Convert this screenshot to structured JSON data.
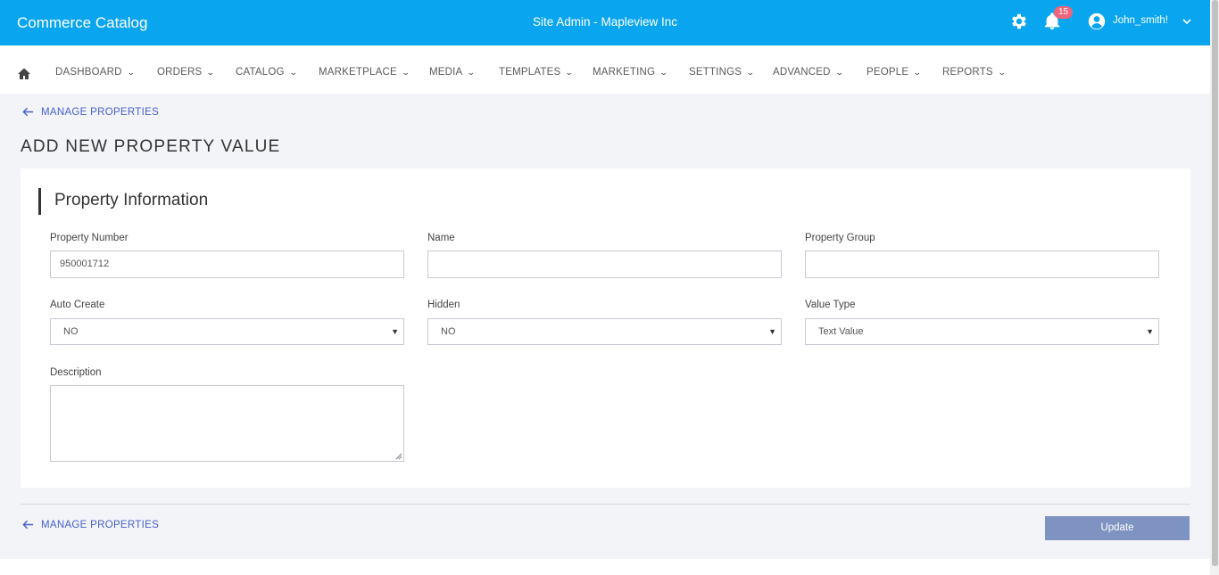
{
  "header": {
    "app_title": "Commerce Catalog",
    "site_title": "Site Admin - Mapleview Inc",
    "notification_count": "15",
    "user_name": "John_smith!",
    "bar_color": "#0aa5ef",
    "icons": [
      "gear-icon",
      "bell-icon",
      "user-icon",
      "chevron-down-icon"
    ]
  },
  "nav": {
    "home_icon": "home-icon",
    "items": [
      {
        "label": "DASHBOARD"
      },
      {
        "label": "ORDERS"
      },
      {
        "label": "CATALOG"
      },
      {
        "label": "MARKETPLACE"
      },
      {
        "label": "MEDIA"
      },
      {
        "label": "TEMPLATES"
      },
      {
        "label": "MARKETING"
      },
      {
        "label": "SETTINGS"
      },
      {
        "label": "ADVANCED"
      },
      {
        "label": "PEOPLE"
      },
      {
        "label": "REPORTS"
      }
    ]
  },
  "page": {
    "back_link": "MANAGE PROPERTIES",
    "title": "ADD NEW PROPERTY VALUE",
    "section_heading": "Property Information",
    "link_color": "#4660cc"
  },
  "form": {
    "property_number": {
      "label": "Property Number",
      "value": "950001712"
    },
    "name": {
      "label": "Name",
      "value": ""
    },
    "property_group": {
      "label": "Property Group",
      "value": ""
    },
    "auto_create": {
      "label": "Auto Create",
      "value": "NO"
    },
    "hidden": {
      "label": "Hidden",
      "value": "NO"
    },
    "value_type": {
      "label": "Value Type",
      "value": "Text Value"
    },
    "description": {
      "label": "Description",
      "value": ""
    }
  },
  "footer": {
    "back_link": "MANAGE PROPERTIES",
    "update_label": "Update",
    "button_color": "#7f93c2"
  }
}
